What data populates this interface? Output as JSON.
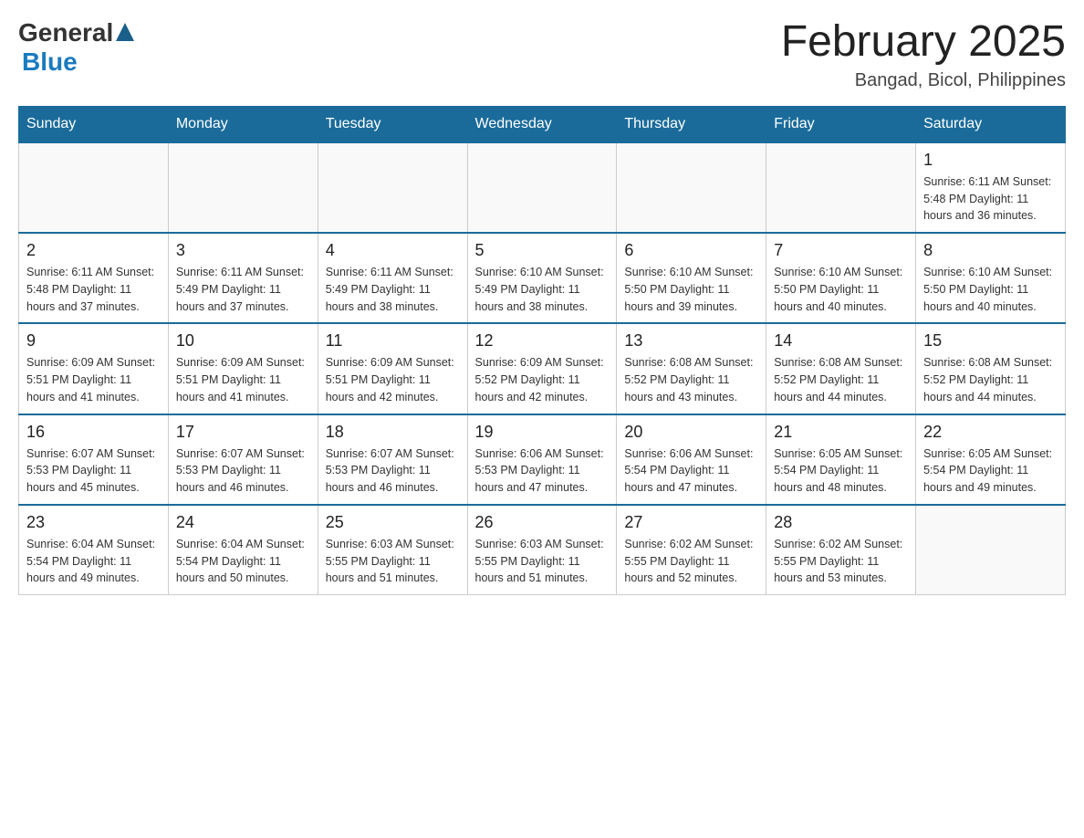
{
  "header": {
    "logo": {
      "general": "General",
      "triangle_symbol": "▲",
      "blue": "Blue"
    },
    "title": "February 2025",
    "location": "Bangad, Bicol, Philippines"
  },
  "days_of_week": [
    "Sunday",
    "Monday",
    "Tuesday",
    "Wednesday",
    "Thursday",
    "Friday",
    "Saturday"
  ],
  "weeks": [
    {
      "days": [
        {
          "num": "",
          "info": ""
        },
        {
          "num": "",
          "info": ""
        },
        {
          "num": "",
          "info": ""
        },
        {
          "num": "",
          "info": ""
        },
        {
          "num": "",
          "info": ""
        },
        {
          "num": "",
          "info": ""
        },
        {
          "num": "1",
          "info": "Sunrise: 6:11 AM\nSunset: 5:48 PM\nDaylight: 11 hours\nand 36 minutes."
        }
      ]
    },
    {
      "days": [
        {
          "num": "2",
          "info": "Sunrise: 6:11 AM\nSunset: 5:48 PM\nDaylight: 11 hours\nand 37 minutes."
        },
        {
          "num": "3",
          "info": "Sunrise: 6:11 AM\nSunset: 5:49 PM\nDaylight: 11 hours\nand 37 minutes."
        },
        {
          "num": "4",
          "info": "Sunrise: 6:11 AM\nSunset: 5:49 PM\nDaylight: 11 hours\nand 38 minutes."
        },
        {
          "num": "5",
          "info": "Sunrise: 6:10 AM\nSunset: 5:49 PM\nDaylight: 11 hours\nand 38 minutes."
        },
        {
          "num": "6",
          "info": "Sunrise: 6:10 AM\nSunset: 5:50 PM\nDaylight: 11 hours\nand 39 minutes."
        },
        {
          "num": "7",
          "info": "Sunrise: 6:10 AM\nSunset: 5:50 PM\nDaylight: 11 hours\nand 40 minutes."
        },
        {
          "num": "8",
          "info": "Sunrise: 6:10 AM\nSunset: 5:50 PM\nDaylight: 11 hours\nand 40 minutes."
        }
      ]
    },
    {
      "days": [
        {
          "num": "9",
          "info": "Sunrise: 6:09 AM\nSunset: 5:51 PM\nDaylight: 11 hours\nand 41 minutes."
        },
        {
          "num": "10",
          "info": "Sunrise: 6:09 AM\nSunset: 5:51 PM\nDaylight: 11 hours\nand 41 minutes."
        },
        {
          "num": "11",
          "info": "Sunrise: 6:09 AM\nSunset: 5:51 PM\nDaylight: 11 hours\nand 42 minutes."
        },
        {
          "num": "12",
          "info": "Sunrise: 6:09 AM\nSunset: 5:52 PM\nDaylight: 11 hours\nand 42 minutes."
        },
        {
          "num": "13",
          "info": "Sunrise: 6:08 AM\nSunset: 5:52 PM\nDaylight: 11 hours\nand 43 minutes."
        },
        {
          "num": "14",
          "info": "Sunrise: 6:08 AM\nSunset: 5:52 PM\nDaylight: 11 hours\nand 44 minutes."
        },
        {
          "num": "15",
          "info": "Sunrise: 6:08 AM\nSunset: 5:52 PM\nDaylight: 11 hours\nand 44 minutes."
        }
      ]
    },
    {
      "days": [
        {
          "num": "16",
          "info": "Sunrise: 6:07 AM\nSunset: 5:53 PM\nDaylight: 11 hours\nand 45 minutes."
        },
        {
          "num": "17",
          "info": "Sunrise: 6:07 AM\nSunset: 5:53 PM\nDaylight: 11 hours\nand 46 minutes."
        },
        {
          "num": "18",
          "info": "Sunrise: 6:07 AM\nSunset: 5:53 PM\nDaylight: 11 hours\nand 46 minutes."
        },
        {
          "num": "19",
          "info": "Sunrise: 6:06 AM\nSunset: 5:53 PM\nDaylight: 11 hours\nand 47 minutes."
        },
        {
          "num": "20",
          "info": "Sunrise: 6:06 AM\nSunset: 5:54 PM\nDaylight: 11 hours\nand 47 minutes."
        },
        {
          "num": "21",
          "info": "Sunrise: 6:05 AM\nSunset: 5:54 PM\nDaylight: 11 hours\nand 48 minutes."
        },
        {
          "num": "22",
          "info": "Sunrise: 6:05 AM\nSunset: 5:54 PM\nDaylight: 11 hours\nand 49 minutes."
        }
      ]
    },
    {
      "days": [
        {
          "num": "23",
          "info": "Sunrise: 6:04 AM\nSunset: 5:54 PM\nDaylight: 11 hours\nand 49 minutes."
        },
        {
          "num": "24",
          "info": "Sunrise: 6:04 AM\nSunset: 5:54 PM\nDaylight: 11 hours\nand 50 minutes."
        },
        {
          "num": "25",
          "info": "Sunrise: 6:03 AM\nSunset: 5:55 PM\nDaylight: 11 hours\nand 51 minutes."
        },
        {
          "num": "26",
          "info": "Sunrise: 6:03 AM\nSunset: 5:55 PM\nDaylight: 11 hours\nand 51 minutes."
        },
        {
          "num": "27",
          "info": "Sunrise: 6:02 AM\nSunset: 5:55 PM\nDaylight: 11 hours\nand 52 minutes."
        },
        {
          "num": "28",
          "info": "Sunrise: 6:02 AM\nSunset: 5:55 PM\nDaylight: 11 hours\nand 53 minutes."
        },
        {
          "num": "",
          "info": ""
        }
      ]
    }
  ]
}
